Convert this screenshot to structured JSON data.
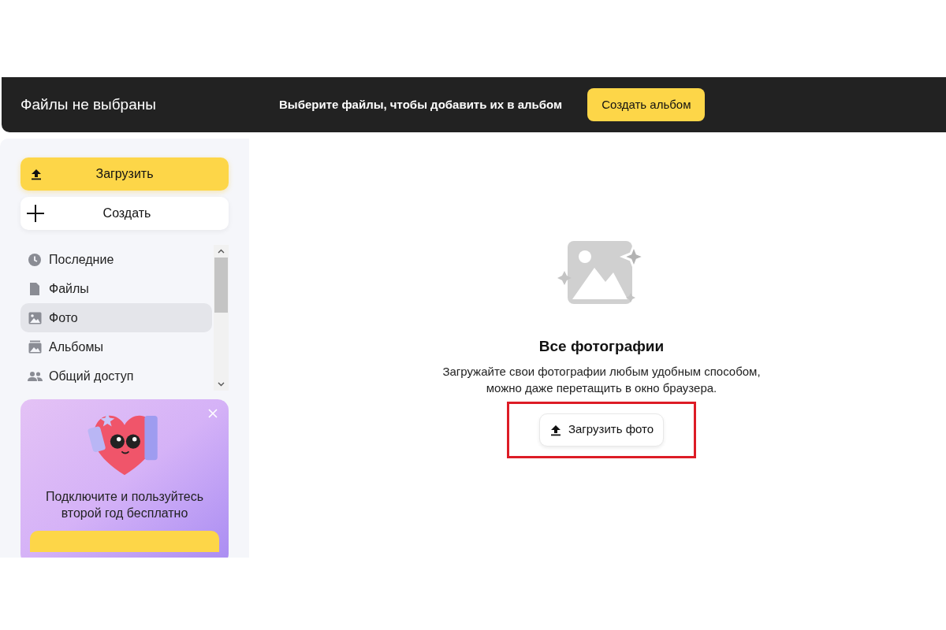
{
  "header": {
    "title": "Файлы не выбраны",
    "hint": "Выберите файлы, чтобы добавить их в альбом",
    "button": "Создать альбом"
  },
  "sidebar": {
    "upload_button": "Загрузить",
    "create_button": "Создать",
    "items": [
      {
        "label": "Последние",
        "kind": "clock",
        "selected": false
      },
      {
        "label": "Файлы",
        "kind": "file",
        "selected": false
      },
      {
        "label": "Фото",
        "kind": "photo",
        "selected": true
      },
      {
        "label": "Альбомы",
        "kind": "album",
        "selected": false
      },
      {
        "label": "Общий доступ",
        "kind": "shared",
        "selected": false
      }
    ],
    "promo": {
      "text": "Подключите и пользуйтесь второй год бесплатно"
    }
  },
  "empty_state": {
    "title": "Все фотографии",
    "description": "Загружайте свои фотографии любым удобным способом, можно даже перетащить в окно браузера.",
    "button": "Загрузить фото",
    "highlighted": true
  }
}
